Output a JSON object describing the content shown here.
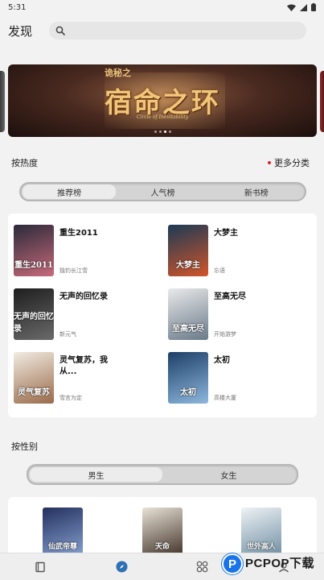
{
  "status_bar": {
    "time": "5:31"
  },
  "header": {
    "title": "发现",
    "search_placeholder": ""
  },
  "banner": {
    "series_text": "诡秘之",
    "title": "宿命之环",
    "subtitle": "Circle of Inevitability",
    "dots_count": 4,
    "active_dot": 2
  },
  "hot_section": {
    "title": "按热度",
    "more_label": "更多分类",
    "tabs": [
      {
        "label": "推荐榜",
        "active": true
      },
      {
        "label": "人气榜",
        "active": false
      },
      {
        "label": "新书榜",
        "active": false
      }
    ],
    "books": [
      {
        "title": "重生2011",
        "author": "独钓长江雪",
        "cover_text": "重生2011",
        "cover_colors": [
          "#2a2a3a",
          "#c86a7a"
        ]
      },
      {
        "title": "大梦主",
        "author": "忘语",
        "cover_text": "大梦主",
        "cover_colors": [
          "#1b3a55",
          "#d2552a"
        ]
      },
      {
        "title": "无声的回忆录",
        "author": "新元气",
        "cover_text": "无声的回忆录",
        "cover_colors": [
          "#1e1e1e",
          "#6a6a6a"
        ]
      },
      {
        "title": "至高无尽",
        "author": "开始游梦",
        "cover_text": "至高无尽",
        "cover_colors": [
          "#e9e9e9",
          "#6a7a8a"
        ]
      },
      {
        "title": "灵气复苏，我从...",
        "author": "雪言为定",
        "cover_text": "灵气复苏",
        "cover_colors": [
          "#f1ebe2",
          "#9a6b4a"
        ]
      },
      {
        "title": "太初",
        "author": "高楼大厦",
        "cover_text": "太初",
        "cover_colors": [
          "#1c3f66",
          "#8fb7de"
        ]
      }
    ]
  },
  "gender_section": {
    "title": "按性别",
    "tabs": [
      {
        "label": "男生",
        "active": true
      },
      {
        "label": "女生",
        "active": false
      }
    ],
    "books": [
      {
        "cover_text": "仙武帝尊",
        "cover_colors": [
          "#24305e",
          "#8aa6d6"
        ]
      },
      {
        "cover_text": "天命",
        "cover_colors": [
          "#e8e2d6",
          "#3a2a20"
        ]
      },
      {
        "cover_text": "世外高人",
        "cover_colors": [
          "#eef2f4",
          "#6a8aa0"
        ]
      }
    ]
  },
  "bottom_nav": {
    "items": [
      {
        "icon": "bookshelf-icon",
        "active": false
      },
      {
        "icon": "compass-icon",
        "active": true
      },
      {
        "icon": "category-icon",
        "active": false
      },
      {
        "icon": "profile-icon",
        "active": false
      }
    ]
  },
  "watermark": {
    "logo_letter": "P",
    "text": "PCPOP下载",
    "small": ""
  },
  "colors": {
    "accent": "#2f6fb5",
    "red_dot": "#d8262b",
    "background": "#f2f2f2"
  }
}
